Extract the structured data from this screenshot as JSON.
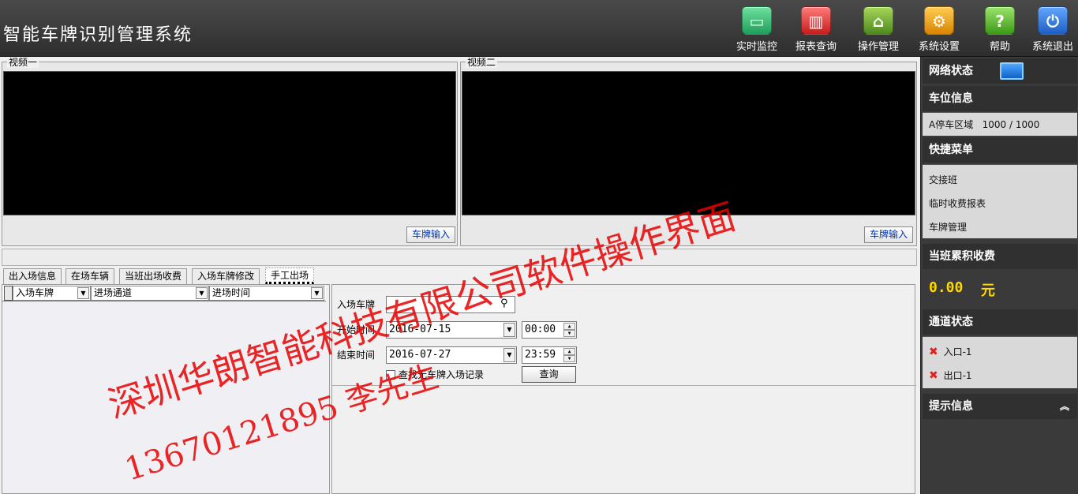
{
  "app": {
    "title": "智能车牌识别管理系统"
  },
  "toolbar": [
    {
      "label": "实时监控",
      "icon": "monitor-icon"
    },
    {
      "label": "报表查询",
      "icon": "report-chart-icon"
    },
    {
      "label": "操作管理",
      "icon": "operation-manage-icon"
    },
    {
      "label": "系统设置",
      "icon": "gear-icon"
    },
    {
      "label": "帮助",
      "icon": "help-question-icon"
    },
    {
      "label": "系统退出",
      "icon": "power-exit-icon"
    }
  ],
  "video": {
    "left": {
      "legend": "视频一",
      "plate_btn": "车牌输入"
    },
    "right": {
      "legend": "视频二",
      "plate_btn": "车牌输入"
    }
  },
  "tabs": [
    {
      "label": "出入场信息"
    },
    {
      "label": "在场车辆"
    },
    {
      "label": "当班出场收费"
    },
    {
      "label": "入场车牌修改"
    },
    {
      "label": "手工出场"
    }
  ],
  "list": {
    "columns": [
      "入场车牌",
      "进场通道",
      "进场时间"
    ]
  },
  "query": {
    "plate_label": "入场车牌",
    "plate_value": "",
    "start_label": "开始时间",
    "start_date": "2016-07-15",
    "start_time": "00:00",
    "end_label": "结束时间",
    "end_date": "2016-07-27",
    "end_time": "23:59",
    "check_label": "查找无车牌入场记录",
    "check_checked": false,
    "search_btn": "查询"
  },
  "sidebar": {
    "network": {
      "title": "网络状态",
      "icon": "network-computer-icon"
    },
    "parking": {
      "title": "车位信息",
      "item": "A停车区域   1000 / 1000"
    },
    "quick_menu": {
      "title": "快捷菜单",
      "items": [
        "交接班",
        "临时收费报表",
        "车牌管理"
      ]
    },
    "fee": {
      "title": "当班累积收费",
      "value": "0.00",
      "unit": "元"
    },
    "channels": {
      "title": "通道状态",
      "items": [
        {
          "label": "入口-1",
          "status": "offline"
        },
        {
          "label": "出口-1",
          "status": "offline"
        }
      ]
    },
    "tips": {
      "title": "提示信息",
      "icon": "double-chevron-up-icon"
    }
  },
  "watermark": {
    "line1": "深圳华朗智能科技有限公司软件操作界面",
    "line2": "13670121895 李先生"
  }
}
